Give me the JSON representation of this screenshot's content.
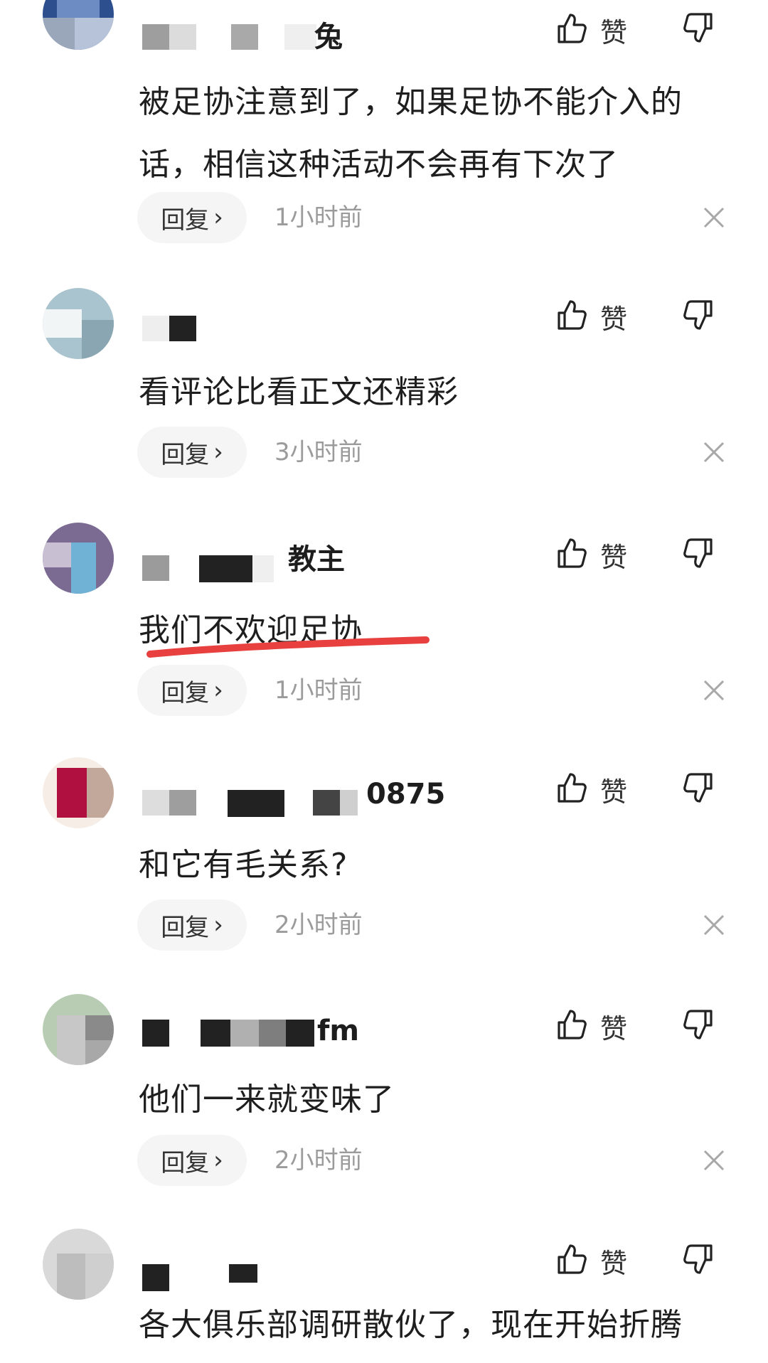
{
  "common": {
    "like_label": "赞",
    "reply_label": "回复",
    "reply_chevron": "›",
    "icons": {
      "like": "thumbs-up-icon",
      "dislike": "thumbs-down-icon",
      "close": "close-icon",
      "chevron": "chevron-right-icon"
    },
    "colors": {
      "text": "#1e1e1e",
      "time": "#9b9b9b",
      "reply_bg": "#f5f5f5",
      "highlight_underline": "#e8403f"
    }
  },
  "comments": [
    {
      "username_visible": "兔",
      "text_lines": [
        "被足协注意到了，如果足协不能介入的",
        "话，相信这种活动不会再有下次了"
      ],
      "time": "1小时前"
    },
    {
      "username_visible": "",
      "text_lines": [
        "看评论比看正文还精彩"
      ],
      "time": "3小时前"
    },
    {
      "username_visible": "教主",
      "text_lines": [
        "我们不欢迎足协"
      ],
      "time": "1小时前",
      "highlighted": true
    },
    {
      "username_visible": "0875",
      "text_lines": [
        "和它有毛关系?"
      ],
      "time": "2小时前"
    },
    {
      "username_visible": "fm",
      "text_lines": [
        "他们一来就变味了"
      ],
      "time": "2小时前"
    },
    {
      "username_visible": "",
      "text_lines": [
        "各大俱乐部调研散伙了，现在开始折腾"
      ],
      "time": ""
    }
  ]
}
